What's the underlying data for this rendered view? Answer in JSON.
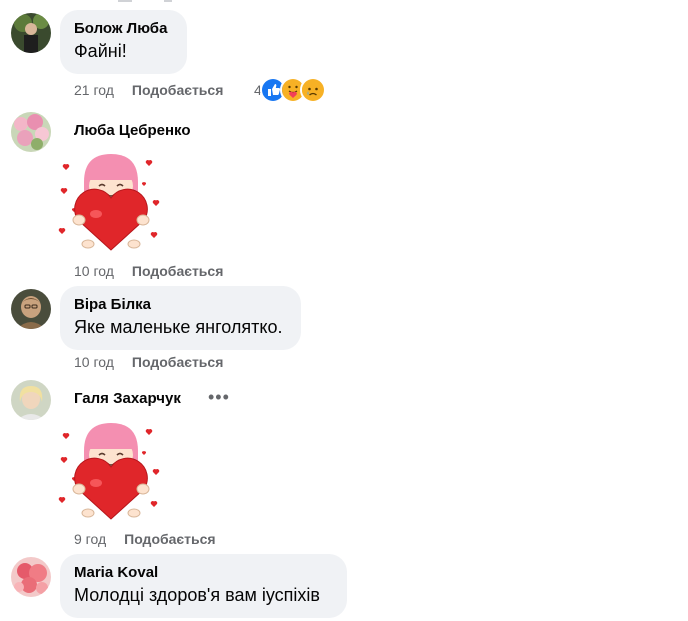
{
  "comments": [
    {
      "author": "Болож Люба",
      "text": "Файні!",
      "time": "21 год",
      "like_label": "Подобається",
      "reactions": {
        "count": "4",
        "icons": [
          "like-icon",
          "care-icon",
          "sad-icon"
        ],
        "colors": {
          "like": "#1877f2",
          "care": "#f7b125",
          "sad": "#f7b125"
        }
      }
    },
    {
      "author": "Люба Цебренко",
      "sticker": "heart-girl-sticker",
      "time": "10 год",
      "like_label": "Подобається"
    },
    {
      "author": "Віра Білка",
      "text": "Яке маленьке янголятко.",
      "time": "10 год",
      "like_label": "Подобається"
    },
    {
      "author": "Галя Захарчук",
      "sticker": "heart-girl-sticker",
      "more_icon": "more-options-icon",
      "time": "9 год",
      "like_label": "Подобається"
    },
    {
      "author": "Maria Koval",
      "text": "Молодці здоров'я вам іуспіхів"
    }
  ],
  "colors": {
    "bubble_bg": "#f0f2f5",
    "meta_text": "#65676b",
    "heart_red": "#e0262a",
    "sticker_hair": "#f48fb1"
  }
}
